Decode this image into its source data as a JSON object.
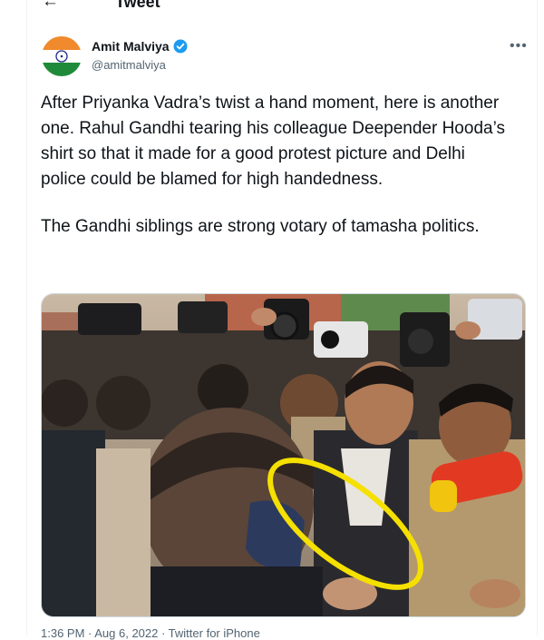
{
  "header": {
    "title": "Tweet"
  },
  "tweet": {
    "author_name": "Amit Malviya",
    "handle": "@amitmalviya",
    "paragraph_1": "After Priyanka Vadra’s twist a hand moment, here is another one. Rahul Gandhi tearing his colleague Deepender Hooda’s shirt so that it made for a good protest picture and Delhi police could be blamed for high handedness.",
    "paragraph_2": "The Gandhi siblings are strong votary of tamasha politics.",
    "meta": "1:36 PM · Aug 6, 2022 · Twitter for iPhone"
  },
  "colors": {
    "highlight_ring": "#f5e000",
    "verified": "#1d9bf0",
    "muted": "#536471"
  },
  "icons": [
    "back-arrow-icon",
    "verified-badge-icon",
    "more-options-icon"
  ]
}
